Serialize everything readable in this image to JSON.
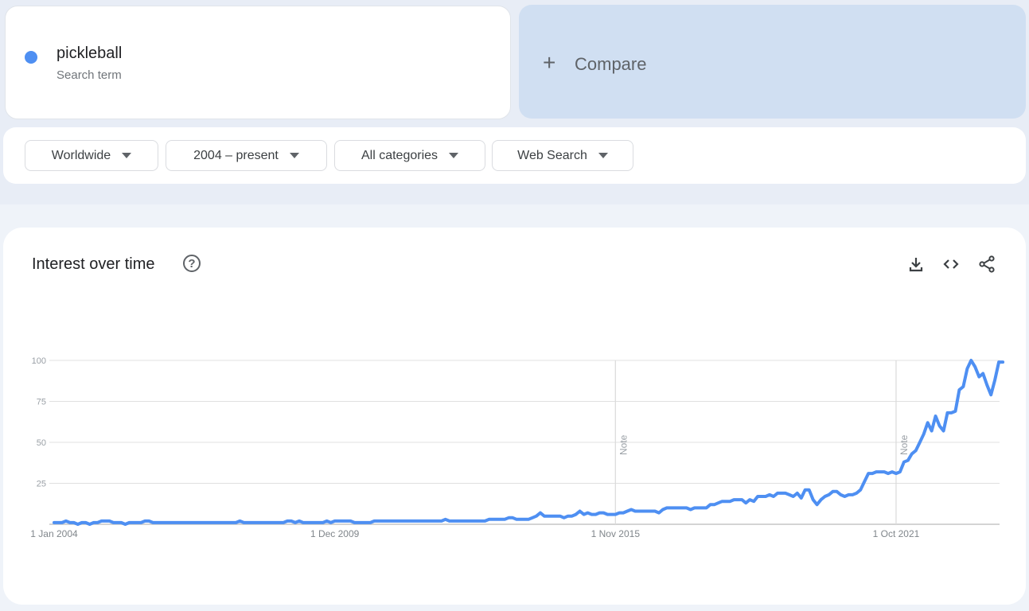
{
  "search_term": {
    "name": "pickleball",
    "subtitle": "Search term",
    "color": "#4e8ff2"
  },
  "compare": {
    "label": "Compare",
    "icon": "plus-icon"
  },
  "filters": [
    {
      "label": "Worldwide"
    },
    {
      "label": "2004 – present"
    },
    {
      "label": "All categories"
    },
    {
      "label": "Web Search"
    }
  ],
  "widget": {
    "title": "Interest over time",
    "help_icon": "?",
    "actions": [
      "download-icon",
      "embed-code-icon",
      "share-icon"
    ]
  },
  "chart_data": {
    "type": "line",
    "title": "Interest over time",
    "xlabel": "",
    "ylabel": "",
    "ylim": [
      0,
      100
    ],
    "y_ticks": [
      25,
      50,
      75,
      100
    ],
    "x_tick_labels": [
      "1 Jan 2004",
      "1 Dec 2009",
      "1 Nov 2015",
      "1 Oct 2021"
    ],
    "x_tick_month_index": [
      0,
      71,
      142,
      213
    ],
    "notes": [
      {
        "label": "Note",
        "month_index": 142
      },
      {
        "label": "Note",
        "month_index": 213
      }
    ],
    "grid": true,
    "legend": "none",
    "start": "Jan 2004",
    "interval": "monthly",
    "series": [
      {
        "name": "pickleball",
        "values": [
          1,
          1,
          1,
          2,
          1,
          1,
          0,
          1,
          1,
          0,
          1,
          1,
          2,
          2,
          2,
          1,
          1,
          1,
          0,
          1,
          1,
          1,
          1,
          2,
          2,
          1,
          1,
          1,
          1,
          1,
          1,
          1,
          1,
          1,
          1,
          1,
          1,
          1,
          1,
          1,
          1,
          1,
          1,
          1,
          1,
          1,
          1,
          2,
          1,
          1,
          1,
          1,
          1,
          1,
          1,
          1,
          1,
          1,
          1,
          2,
          2,
          1,
          2,
          1,
          1,
          1,
          1,
          1,
          1,
          2,
          1,
          2,
          2,
          2,
          2,
          2,
          1,
          1,
          1,
          1,
          1,
          2,
          2,
          2,
          2,
          2,
          2,
          2,
          2,
          2,
          2,
          2,
          2,
          2,
          2,
          2,
          2,
          2,
          2,
          3,
          2,
          2,
          2,
          2,
          2,
          2,
          2,
          2,
          2,
          2,
          3,
          3,
          3,
          3,
          3,
          4,
          4,
          3,
          3,
          3,
          3,
          4,
          5,
          7,
          5,
          5,
          5,
          5,
          5,
          4,
          5,
          5,
          6,
          8,
          6,
          7,
          6,
          6,
          7,
          7,
          6,
          6,
          6,
          7,
          7,
          8,
          9,
          8,
          8,
          8,
          8,
          8,
          8,
          7,
          9,
          10,
          10,
          10,
          10,
          10,
          10,
          9,
          10,
          10,
          10,
          10,
          12,
          12,
          13,
          14,
          14,
          14,
          15,
          15,
          15,
          13,
          15,
          14,
          17,
          17,
          17,
          18,
          17,
          19,
          19,
          19,
          18,
          17,
          19,
          16,
          21,
          21,
          15,
          12,
          15,
          17,
          18,
          20,
          20,
          18,
          17,
          18,
          18,
          19,
          21,
          26,
          31,
          31,
          32,
          32,
          32,
          31,
          32,
          31,
          32,
          38,
          39,
          43,
          45,
          50,
          55,
          62,
          57,
          66,
          60,
          57,
          68,
          68,
          69,
          82,
          84,
          95,
          100,
          96,
          90,
          92,
          85,
          79,
          88,
          99,
          99
        ]
      }
    ]
  }
}
